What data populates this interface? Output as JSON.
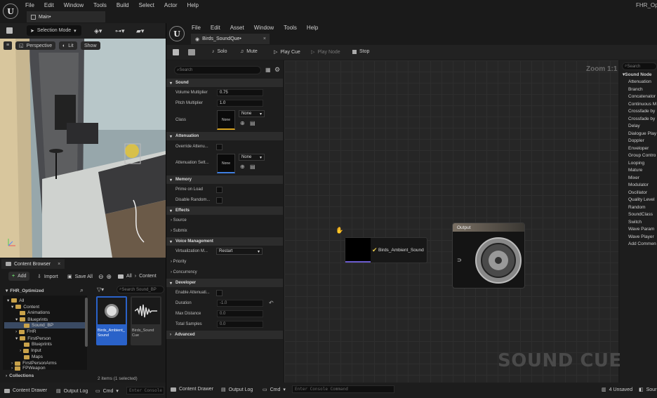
{
  "main_window": {
    "menu": [
      "File",
      "Edit",
      "Window",
      "Tools",
      "Build",
      "Select",
      "Actor",
      "Help"
    ],
    "tab_label": "Main•",
    "title_right": "FHR_Opti",
    "selection_mode": "Selection Mode"
  },
  "viewport": {
    "buttons": [
      "Perspective",
      "Lit",
      "Show"
    ]
  },
  "content_browser": {
    "tab_label": "Content Browser",
    "add_label": "Add",
    "import_label": "Import",
    "save_all_label": "Save All",
    "path": [
      "All",
      "Content"
    ],
    "project": "FHR_Optimized",
    "search_placeholder": "Search Sound_BP",
    "tree": [
      "All",
      "Content",
      "Animations",
      "Blueprints",
      "Sound_BP",
      "FHR",
      "FirstPerson",
      "Blueprints",
      "Input",
      "Maps",
      "FirstPersonArms",
      "FPWeapon"
    ],
    "assets": [
      {
        "name": "Birds_Ambient_Sound"
      },
      {
        "name": "Birds_Sound Cue"
      }
    ],
    "item_count": "2 items (1 selected)",
    "collections_label": "Collections"
  },
  "bottom_bar_left": {
    "content_drawer": "Content Drawer",
    "output_log": "Output Log",
    "cmd": "Cmd",
    "console_placeholder": "Enter Console"
  },
  "editor": {
    "menu": [
      "File",
      "Edit",
      "Asset",
      "Window",
      "Tools",
      "Help"
    ],
    "tab_label": "Birds_SoundQue•",
    "toolbar": [
      "Solo",
      "Mute",
      "Play Cue",
      "Play Node",
      "Stop"
    ]
  },
  "details": {
    "search_placeholder": "Search",
    "sections": [
      "Sound",
      "Attenuation",
      "Memory",
      "Effects",
      "Voice Management",
      "Developer",
      "Advanced"
    ],
    "sound": {
      "volume_multiplier_label": "Volume Multiplier",
      "volume_multiplier": "0.75",
      "pitch_multiplier_label": "Pitch Multiplier",
      "pitch_multiplier": "1.0",
      "class_label": "Class",
      "class_value": "None",
      "class_thumb": "None"
    },
    "attenuation": {
      "override_label": "Override Attenu...",
      "settings_label": "Attenuation Sett...",
      "settings_value": "None",
      "settings_thumb": "None"
    },
    "memory": {
      "prime_label": "Prime on Load",
      "disable_label": "Disable Random..."
    },
    "effects": {
      "source_label": "Source",
      "submix_label": "Submix"
    },
    "voice": {
      "virtualization_label": "Virtualization M...",
      "virtualization_value": "Restart",
      "priority_label": "Priority",
      "concurrency_label": "Concurrency"
    },
    "developer": {
      "enable_label": "Enable Attenuati...",
      "duration_label": "Duration",
      "duration_value": "-1.0",
      "max_distance_label": "Max Distance",
      "max_distance_value": "0.0",
      "total_samples_label": "Total Samples",
      "total_samples_value": "0.0"
    }
  },
  "graph": {
    "zoom": "Zoom 1:1",
    "wave_node": "Birds_Ambient_Sound",
    "output_node": "Output",
    "watermark": "SOUND CUE"
  },
  "palette": {
    "search_placeholder": "Search",
    "header": "Sound Node",
    "items": [
      "Attenuation",
      "Branch",
      "Concatenator",
      "Continuous M",
      "Crossfade by",
      "Crossfade by",
      "Delay",
      "Dialogue Play",
      "Doppler",
      "Enveloper",
      "Group Contro",
      "Looping",
      "Mature",
      "Mixer",
      "Modulator",
      "Oscillator",
      "Quality Level",
      "Random",
      "SoundClass",
      "Switch",
      "Wave Param",
      "Wave Player",
      "Add Commen"
    ]
  },
  "bottom_bar_right": {
    "content_drawer": "Content Drawer",
    "output_log": "Output Log",
    "cmd": "Cmd",
    "console_placeholder": "Enter Console Command",
    "unsaved": "4 Unsaved",
    "source": "Sour"
  },
  "colors": {
    "accent_blue": "#2b6bd6",
    "selection_blue": "#2f6bc9",
    "node_header": "#7a7064",
    "watermark": "#3c3c3c"
  }
}
